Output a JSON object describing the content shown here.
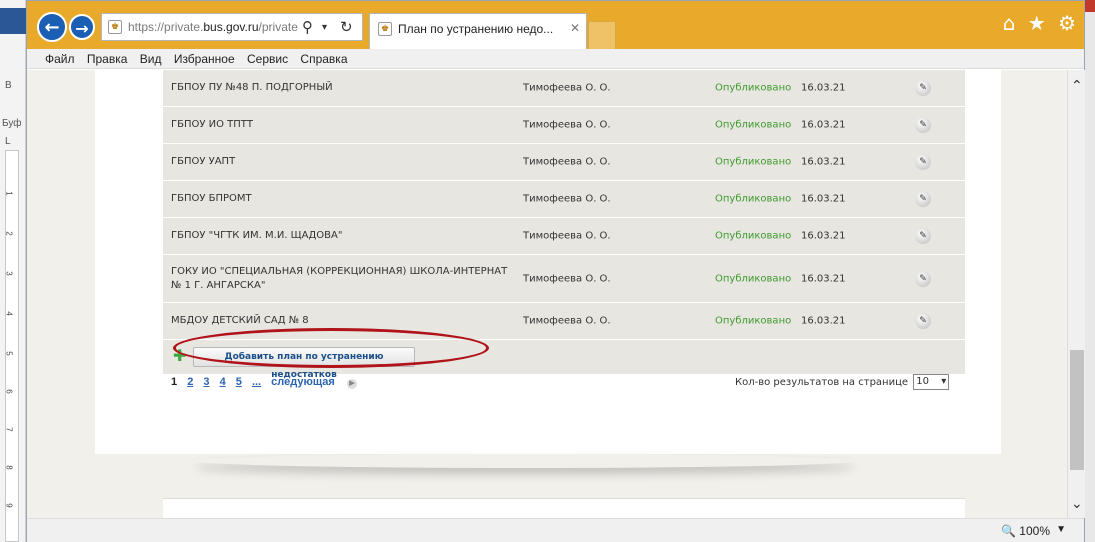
{
  "background": {
    "left_labels": [
      "В",
      "Буф",
      "L"
    ],
    "ruler_marks": [
      "1",
      "2",
      "3",
      "4",
      "5",
      "6",
      "7",
      "8",
      "9"
    ]
  },
  "browser": {
    "url_prefix": "https://private.",
    "url_domain": "bus.gov.ru",
    "url_suffix": "/private",
    "tab_title": "План по устранению недо...",
    "accent": "#e9aa2b"
  },
  "menu": [
    "Файл",
    "Правка",
    "Вид",
    "Избранное",
    "Сервис",
    "Справка"
  ],
  "table": {
    "rows": [
      {
        "org": "ГБПОУ ПУ №48 П. ПОДГОРНЫЙ",
        "author": "Тимофеева О. О.",
        "status": "Опубликовано",
        "date": "16.03.21"
      },
      {
        "org": "ГБПОУ ИО ТПТТ",
        "author": "Тимофеева О. О.",
        "status": "Опубликовано",
        "date": "16.03.21"
      },
      {
        "org": "ГБПОУ УАПТ",
        "author": "Тимофеева О. О.",
        "status": "Опубликовано",
        "date": "16.03.21"
      },
      {
        "org": "ГБПОУ БПРОМТ",
        "author": "Тимофеева О. О.",
        "status": "Опубликовано",
        "date": "16.03.21"
      },
      {
        "org": "ГБПОУ \"ЧГТК ИМ. М.И. ЩАДОВА\"",
        "author": "Тимофеева О. О.",
        "status": "Опубликовано",
        "date": "16.03.21"
      },
      {
        "org": "ГОКУ ИО \"СПЕЦИАЛЬНАЯ (КОРРЕКЦИОННАЯ) ШКОЛА-ИНТЕРНАТ № 1 Г. АНГАРСКА\"",
        "author": "Тимофеева О. О.",
        "status": "Опубликовано",
        "date": "16.03.21"
      },
      {
        "org": "МБДОУ ДЕТСКИЙ САД № 8",
        "author": "Тимофеева О. О.",
        "status": "Опубликовано",
        "date": "16.03.21"
      }
    ],
    "status_color": "#3f9b2e"
  },
  "actions": {
    "add_label": "Добавить план по устранению недостатков"
  },
  "pagination": {
    "current": "1",
    "pages": [
      "2",
      "3",
      "4",
      "5",
      "..."
    ],
    "next_label": "следующая",
    "per_page_label": "Кол-во результатов на странице",
    "per_page_value": "10"
  },
  "statusbar": {
    "zoom": "100%"
  }
}
